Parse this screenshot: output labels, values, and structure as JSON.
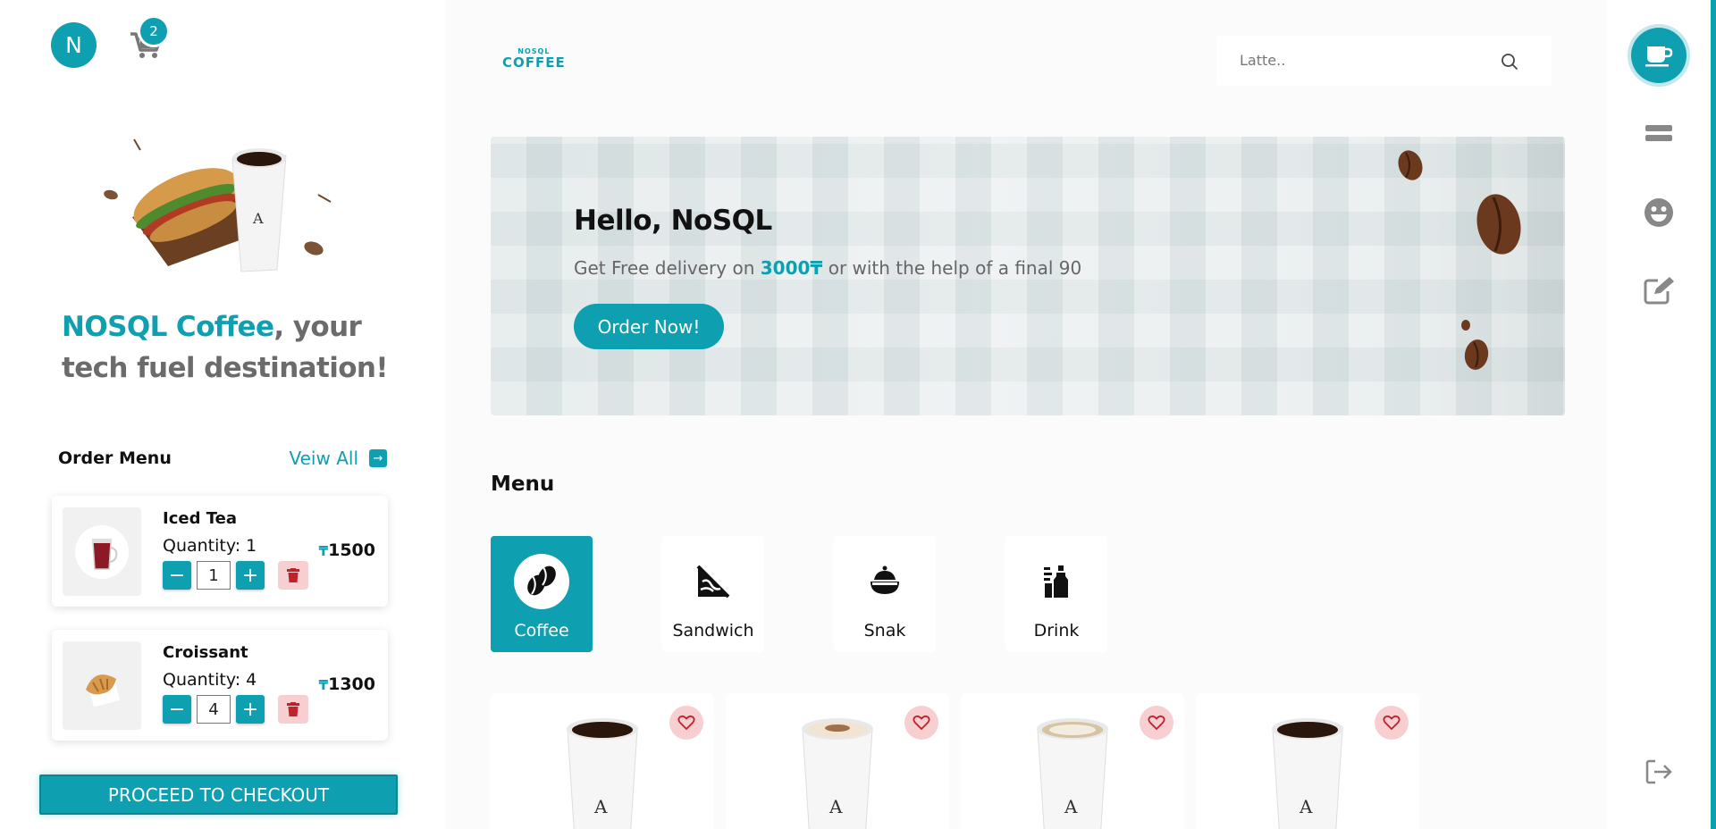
{
  "user": {
    "avatar_initial": "N"
  },
  "cart": {
    "count": "2"
  },
  "tagline": {
    "accent": "NOSQL Coffee",
    "rest": ", your tech fuel destination!"
  },
  "order_menu": {
    "title": "Order Menu",
    "view_all": "Veiw All",
    "items": [
      {
        "name": "Iced Tea",
        "quantity_label": "Quantity: 1",
        "quantity": "1",
        "currency": "₸",
        "price": "1500"
      },
      {
        "name": "Croissant",
        "quantity_label": "Quantity: 4",
        "quantity": "4",
        "currency": "₸",
        "price": "1300"
      }
    ],
    "minus": "−",
    "plus": "+"
  },
  "checkout_label": "PROCEED TO CHECKOUT",
  "header": {
    "logo_small": "NOSQL",
    "logo_big": "COFFEE",
    "search_placeholder": "Latte.."
  },
  "banner": {
    "greeting": "Hello, NoSQL",
    "subtitle_pre": "Get Free delivery on ",
    "subtitle_highlight": "3000₸",
    "subtitle_post": " or with the help of a final 90",
    "cta": "Order Now!"
  },
  "menu": {
    "title": "Menu",
    "categories": [
      {
        "label": "Coffee",
        "icon": "coffee-beans-icon",
        "active": true
      },
      {
        "label": "Sandwich",
        "icon": "sandwich-icon",
        "active": false
      },
      {
        "label": "Snak",
        "icon": "snack-bowl-icon",
        "active": false
      },
      {
        "label": "Drink",
        "icon": "drink-bottles-icon",
        "active": false
      }
    ]
  },
  "right_rail": [
    "coffee-cup-icon",
    "menu-bars-icon",
    "smile-icon",
    "edit-icon",
    "logout-icon"
  ],
  "colors": {
    "accent": "#0e9fb0",
    "favorite_bg": "#f7cfd1",
    "delete": "#c0212b"
  }
}
